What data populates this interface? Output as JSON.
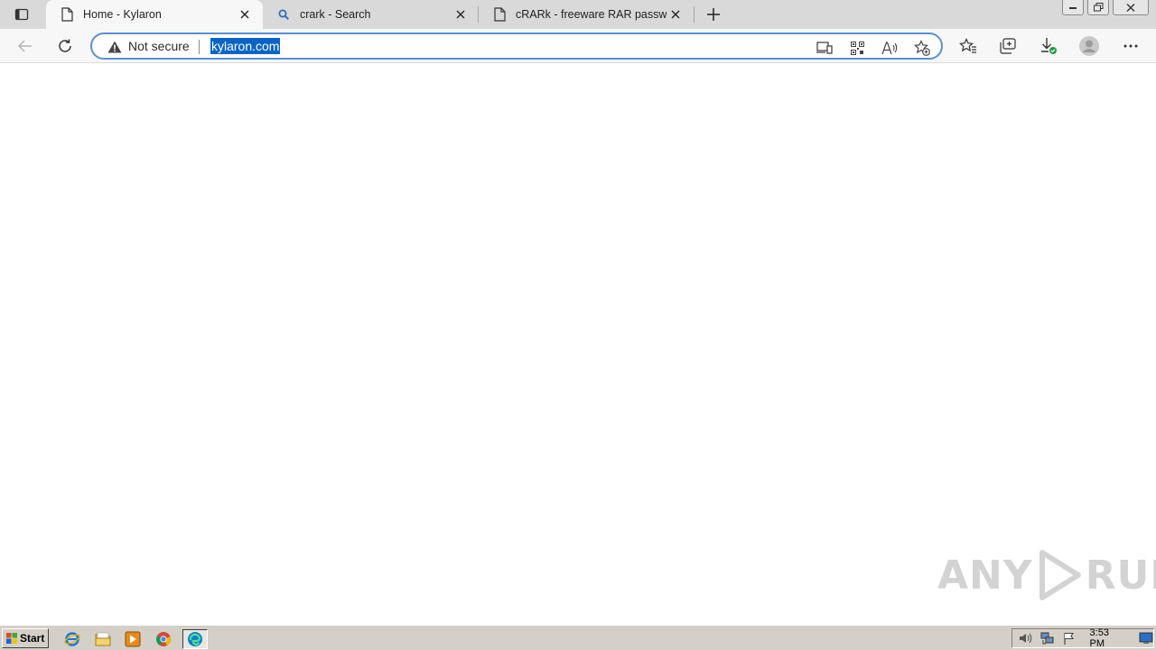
{
  "browser": {
    "tabs": [
      {
        "title": "Home - Kylaron",
        "active": true,
        "icon": "page-icon"
      },
      {
        "title": "crark - Search",
        "active": false,
        "icon": "search-icon"
      },
      {
        "title": "cRARk - freeware RAR password",
        "active": false,
        "icon": "page-icon"
      }
    ],
    "address": {
      "security_label": "Not secure",
      "url": "kylaron.com"
    }
  },
  "watermark": {
    "left": "ANY",
    "right": "RUN"
  },
  "taskbar": {
    "start_label": "Start",
    "clock": "3:53 PM",
    "quicklaunch": [
      "ie-icon",
      "folder-icon",
      "media-player-icon",
      "chrome-icon",
      "edge-icon"
    ]
  },
  "colors": {
    "tab_strip": "#d9d9d9",
    "toolbar": "#f7f7f7",
    "address_border": "#5a8fd6",
    "url_selection": "#0a64c8",
    "taskbar": "#d4d0c8"
  }
}
